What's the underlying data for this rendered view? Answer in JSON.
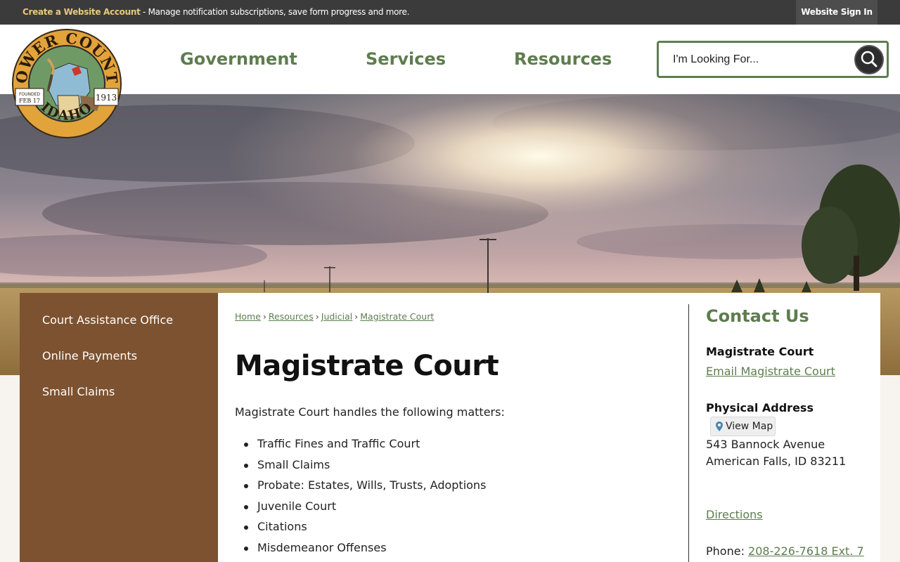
{
  "topbar": {
    "create_account_link": "Create a Website Account",
    "message": " - Manage notification subscriptions, save form progress and more.",
    "sign_in": "Website Sign In"
  },
  "logo": {
    "top_text": "POWER COUNTY",
    "bottom_text": "IDAHO",
    "founded_label": "FOUNDED",
    "founded_date": "FEB 17",
    "year": "1913"
  },
  "nav": {
    "items": [
      "Government",
      "Services",
      "Resources"
    ]
  },
  "search": {
    "placeholder": "I'm Looking For..."
  },
  "sidebar": {
    "items": [
      "Court Assistance Office",
      "Online Payments",
      "Small Claims"
    ]
  },
  "breadcrumb": {
    "items": [
      "Home",
      "Resources",
      "Judicial",
      "Magistrate Court"
    ],
    "separator": "›"
  },
  "main": {
    "title": "Magistrate Court",
    "intro": "Magistrate Court handles the following matters:",
    "matters": [
      "Traffic Fines and Traffic Court",
      "Small Claims",
      "Probate: Estates, Wills, Trusts, Adoptions",
      "Juvenile Court",
      "Citations",
      "Misdemeanor Offenses"
    ]
  },
  "contact": {
    "heading": "Contact Us",
    "department": "Magistrate Court",
    "email_link": "Email Magistrate Court",
    "address_label": "Physical Address",
    "view_map": "View Map",
    "street": "543 Bannock Avenue",
    "city_state_zip": "American Falls, ID 83211",
    "directions": "Directions",
    "phone_label": "Phone: ",
    "phone": "208-226-7618 Ext. 7"
  },
  "colors": {
    "brand_green": "#5e7d4f",
    "sidebar_brown": "#7c5230",
    "topbar": "#3b3b3b",
    "logo_gold": "#e2a33a"
  },
  "icons": {
    "search": "search-icon",
    "map_pin": "map-pin-icon"
  }
}
